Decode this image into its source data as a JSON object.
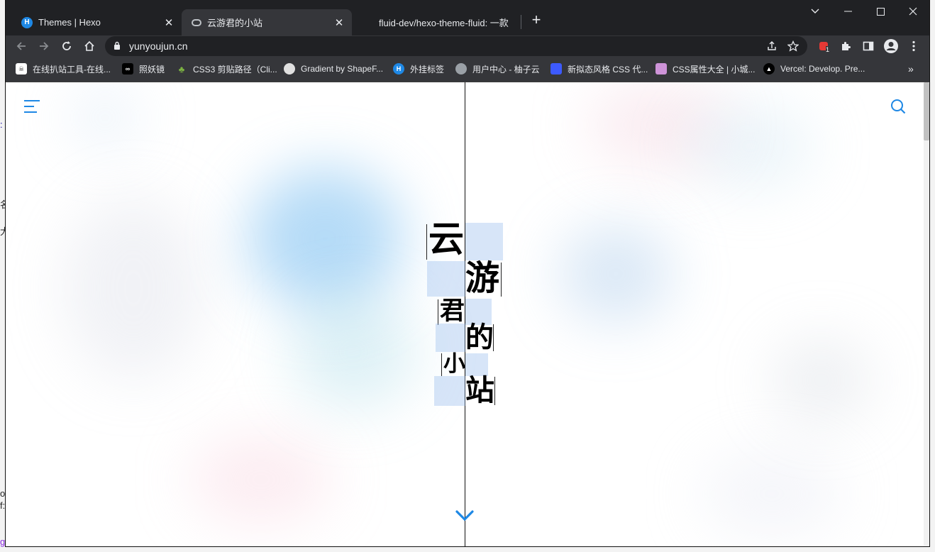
{
  "background_page": {
    "fragments": [
      ":",
      "名",
      "大",
      "o:",
      "f:",
      "g"
    ]
  },
  "tabs": [
    {
      "title": "Themes | Hexo",
      "icon": "hexo-icon",
      "active": false
    },
    {
      "title": "云游君的小站",
      "icon": "site-icon",
      "active": true
    },
    {
      "title": "fluid-dev/hexo-theme-fluid: 一款",
      "icon": "github-icon",
      "active": false
    }
  ],
  "toolbar": {
    "url": "yunyoujun.cn",
    "extension_badge": "1"
  },
  "bookmarks": [
    {
      "label": "在线扒站工具-在线...",
      "icon": "ghost-icon"
    },
    {
      "label": "照妖镜",
      "icon": "infinity-icon"
    },
    {
      "label": "CSS3 剪贴路径（Cli...",
      "icon": "sprout-icon"
    },
    {
      "label": "Gradient by ShapeF...",
      "icon": "gradient-icon"
    },
    {
      "label": "外挂标签",
      "icon": "hexo-icon"
    },
    {
      "label": "用户中心 - 柚子云",
      "icon": "globe-icon"
    },
    {
      "label": "新拟态风格 CSS 代...",
      "icon": "neumorphism-icon"
    },
    {
      "label": "CSS属性大全 | 小城...",
      "icon": "css-icon"
    },
    {
      "label": "Vercel: Develop. Pre...",
      "icon": "vercel-icon"
    }
  ],
  "hero": {
    "chars": [
      "云",
      "游",
      "君",
      "的",
      "小",
      "站"
    ]
  },
  "colors": {
    "accent": "#1e88e5",
    "chrome_dark": "#202124",
    "chrome_mid": "#35363a"
  }
}
